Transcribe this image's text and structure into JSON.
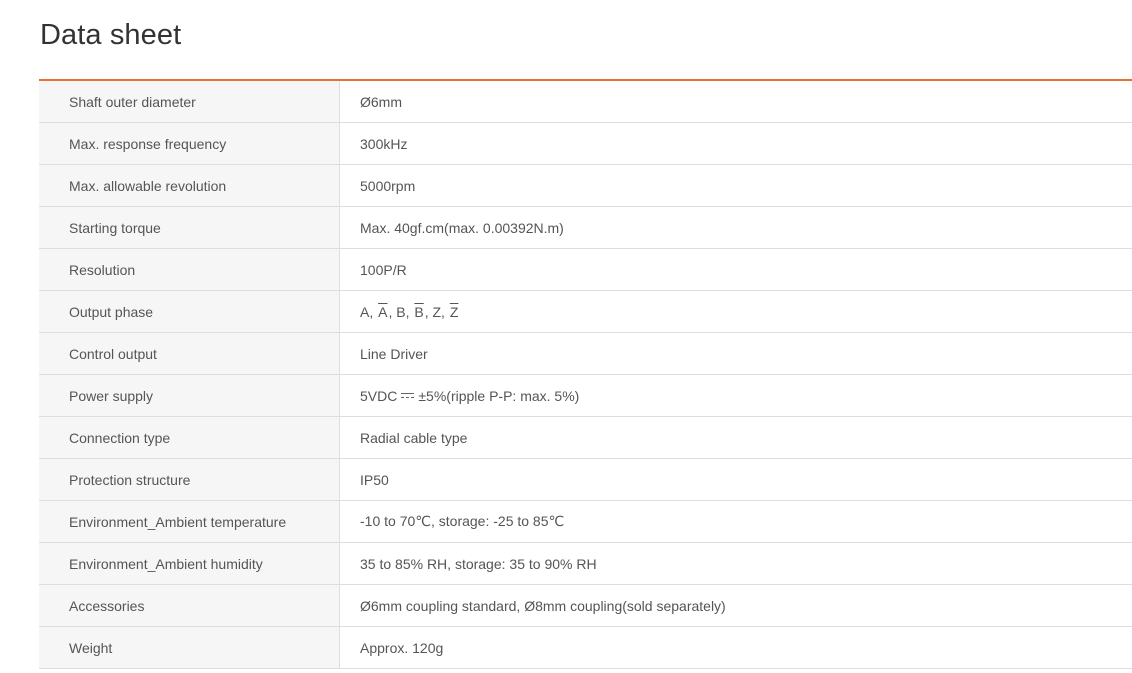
{
  "page": {
    "title": "Data sheet"
  },
  "rows": [
    {
      "label": "Shaft outer diameter",
      "value": "Ø6mm"
    },
    {
      "label": "Max. response frequency",
      "value": "300kHz"
    },
    {
      "label": "Max. allowable revolution",
      "value": "5000rpm"
    },
    {
      "label": "Starting torque",
      "value": "Max. 40gf.cm(max. 0.00392N.m)"
    },
    {
      "label": "Resolution",
      "value": "100P/R"
    },
    {
      "label": "Output phase",
      "value_parts": [
        "A, ",
        "A",
        ", B, ",
        "B",
        ", Z, ",
        "Z"
      ]
    },
    {
      "label": "Control output",
      "value": "Line Driver"
    },
    {
      "label": "Power supply",
      "value_before": "5VDC",
      "value_after": "±5%(ripple P-P: max. 5%)",
      "symbol": "dc-voltage-icon"
    },
    {
      "label": "Connection type",
      "value": "Radial cable type"
    },
    {
      "label": "Protection structure",
      "value": "IP50"
    },
    {
      "label": "Environment_Ambient temperature",
      "value": "-10 to 70℃, storage: -25 to 85℃"
    },
    {
      "label": "Environment_Ambient humidity",
      "value": "35 to 85% RH, storage: 35 to 90% RH"
    },
    {
      "label": "Accessories",
      "value": "Ø6mm coupling standard, Ø8mm coupling(sold separately)"
    },
    {
      "label": "Weight",
      "value": "Approx. 120g"
    }
  ],
  "colors": {
    "accent": "#e8732d",
    "label_bg": "#f6f6f6",
    "border": "#dedede",
    "text": "#555555"
  }
}
